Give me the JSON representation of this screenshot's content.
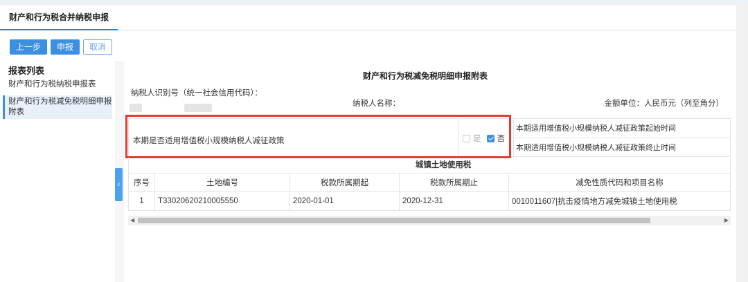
{
  "tab": {
    "label": "财产和行为税合并纳税申报"
  },
  "toolbar": {
    "prev_label": "上一步",
    "submit_label": "申报",
    "cancel_label": "取消"
  },
  "sidebar": {
    "title": "报表列表",
    "items": [
      {
        "label": "财产和行为税纳税申报表"
      },
      {
        "label": "财产和行为税减免税明细申报附表"
      }
    ]
  },
  "form": {
    "title": "财产和行为税减免税明细申报附表",
    "taxpayer_id_label": "纳税人识别号（统一社会信用代码）：",
    "taxpayer_name_label": "纳税人名称：",
    "unit": "金额单位：人民币元（列至角分）"
  },
  "policy": {
    "question": "本期是否适用增值税小规模纳税人减征政策",
    "yes_label": "是",
    "no_label": "否",
    "selected": "否",
    "start_label": "本期适用增值税小规模纳税人减征政策起始时间",
    "end_label": "本期适用增值税小规模纳税人减征政策终止时间"
  },
  "section": {
    "title": "城镇土地使用税"
  },
  "table": {
    "headers": [
      "序号",
      "土地编号",
      "税款所属期起",
      "税款所属期止",
      "减免性质代码和项目名称"
    ],
    "rows": [
      [
        "1",
        "T33020620210005550",
        "2020-01-01",
        "2020-12-31",
        "0010011607|抗击疫情地方减免城镇土地使用税"
      ]
    ]
  },
  "colors": {
    "accent": "#3d8fe0",
    "highlight": "#e53935"
  }
}
